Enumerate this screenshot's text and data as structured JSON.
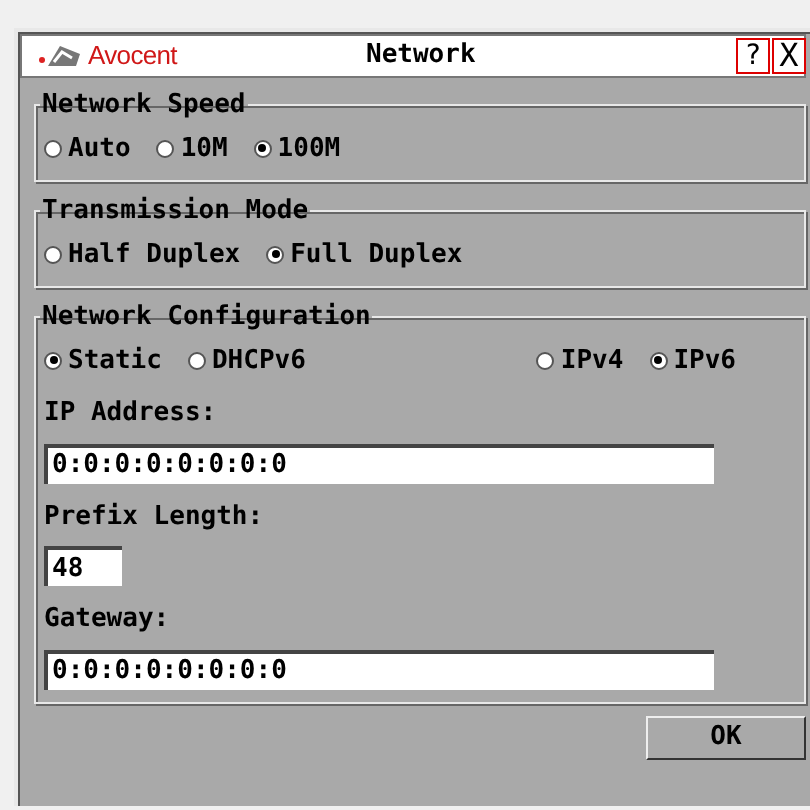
{
  "window": {
    "brand": "Avocent",
    "title": "Network",
    "help": "?",
    "close": "X"
  },
  "groups": [
    {
      "title": "Network Speed",
      "rows": [
        {
          "kind": "radios",
          "options": [
            {
              "label": "Auto",
              "selected": false
            },
            {
              "label": "10M",
              "selected": false
            },
            {
              "label": "100M",
              "selected": true
            }
          ]
        }
      ]
    },
    {
      "title": "Transmission Mode",
      "rows": [
        {
          "kind": "radios",
          "options": [
            {
              "label": "Half Duplex",
              "selected": false
            },
            {
              "label": "Full Duplex",
              "selected": true
            }
          ]
        }
      ]
    },
    {
      "title": "Network Configuration",
      "rows": [
        {
          "kind": "split-radios",
          "options": [
            {
              "label": "Static",
              "selected": true
            },
            {
              "label": "DHCPv6",
              "selected": false
            }
          ],
          "options_right": [
            {
              "label": "IPv4",
              "selected": false
            },
            {
              "label": "IPv6",
              "selected": true
            }
          ]
        },
        {
          "kind": "field",
          "label": "IP Address:",
          "value": "0:0:0:0:0:0:0:0"
        },
        {
          "kind": "short-field",
          "label": "Prefix Length:",
          "value": "48"
        },
        {
          "kind": "field",
          "label": "Gateway:",
          "value": "0:0:0:0:0:0:0:0"
        }
      ]
    }
  ],
  "buttons": [
    {
      "label": "OK"
    }
  ]
}
